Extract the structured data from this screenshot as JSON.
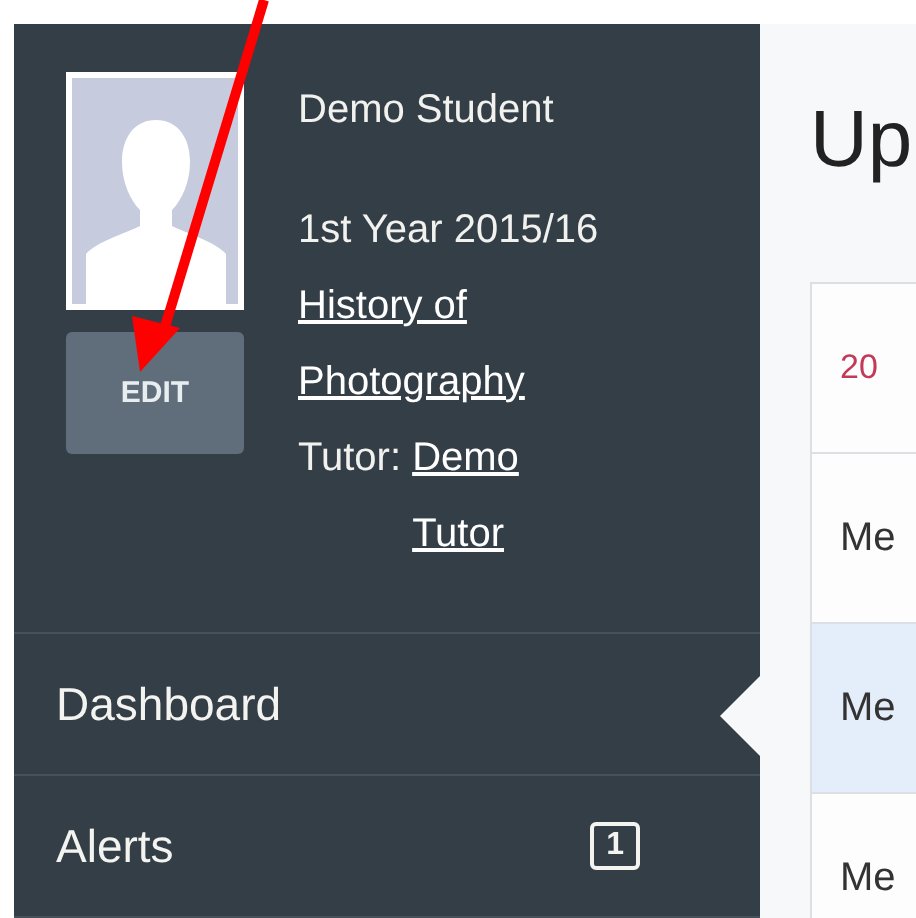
{
  "profile": {
    "name": "Demo Student",
    "edit_button": "EDIT",
    "year": "1st Year 2015/16",
    "course": "History of Photography",
    "tutor_label": "Tutor:",
    "tutor": "Demo Tutor"
  },
  "nav": [
    {
      "label": "Dashboard",
      "selected": true
    },
    {
      "label": "Alerts",
      "selected": false,
      "badge": "1"
    }
  ],
  "main": {
    "heading": "Up",
    "table": {
      "rows": [
        {
          "kind": "date",
          "text": "20",
          "selected": false
        },
        {
          "kind": "item",
          "text": "Me",
          "selected": false
        },
        {
          "kind": "item",
          "text": "Me",
          "selected": true
        },
        {
          "kind": "item",
          "text": "Me",
          "selected": false
        }
      ]
    }
  }
}
